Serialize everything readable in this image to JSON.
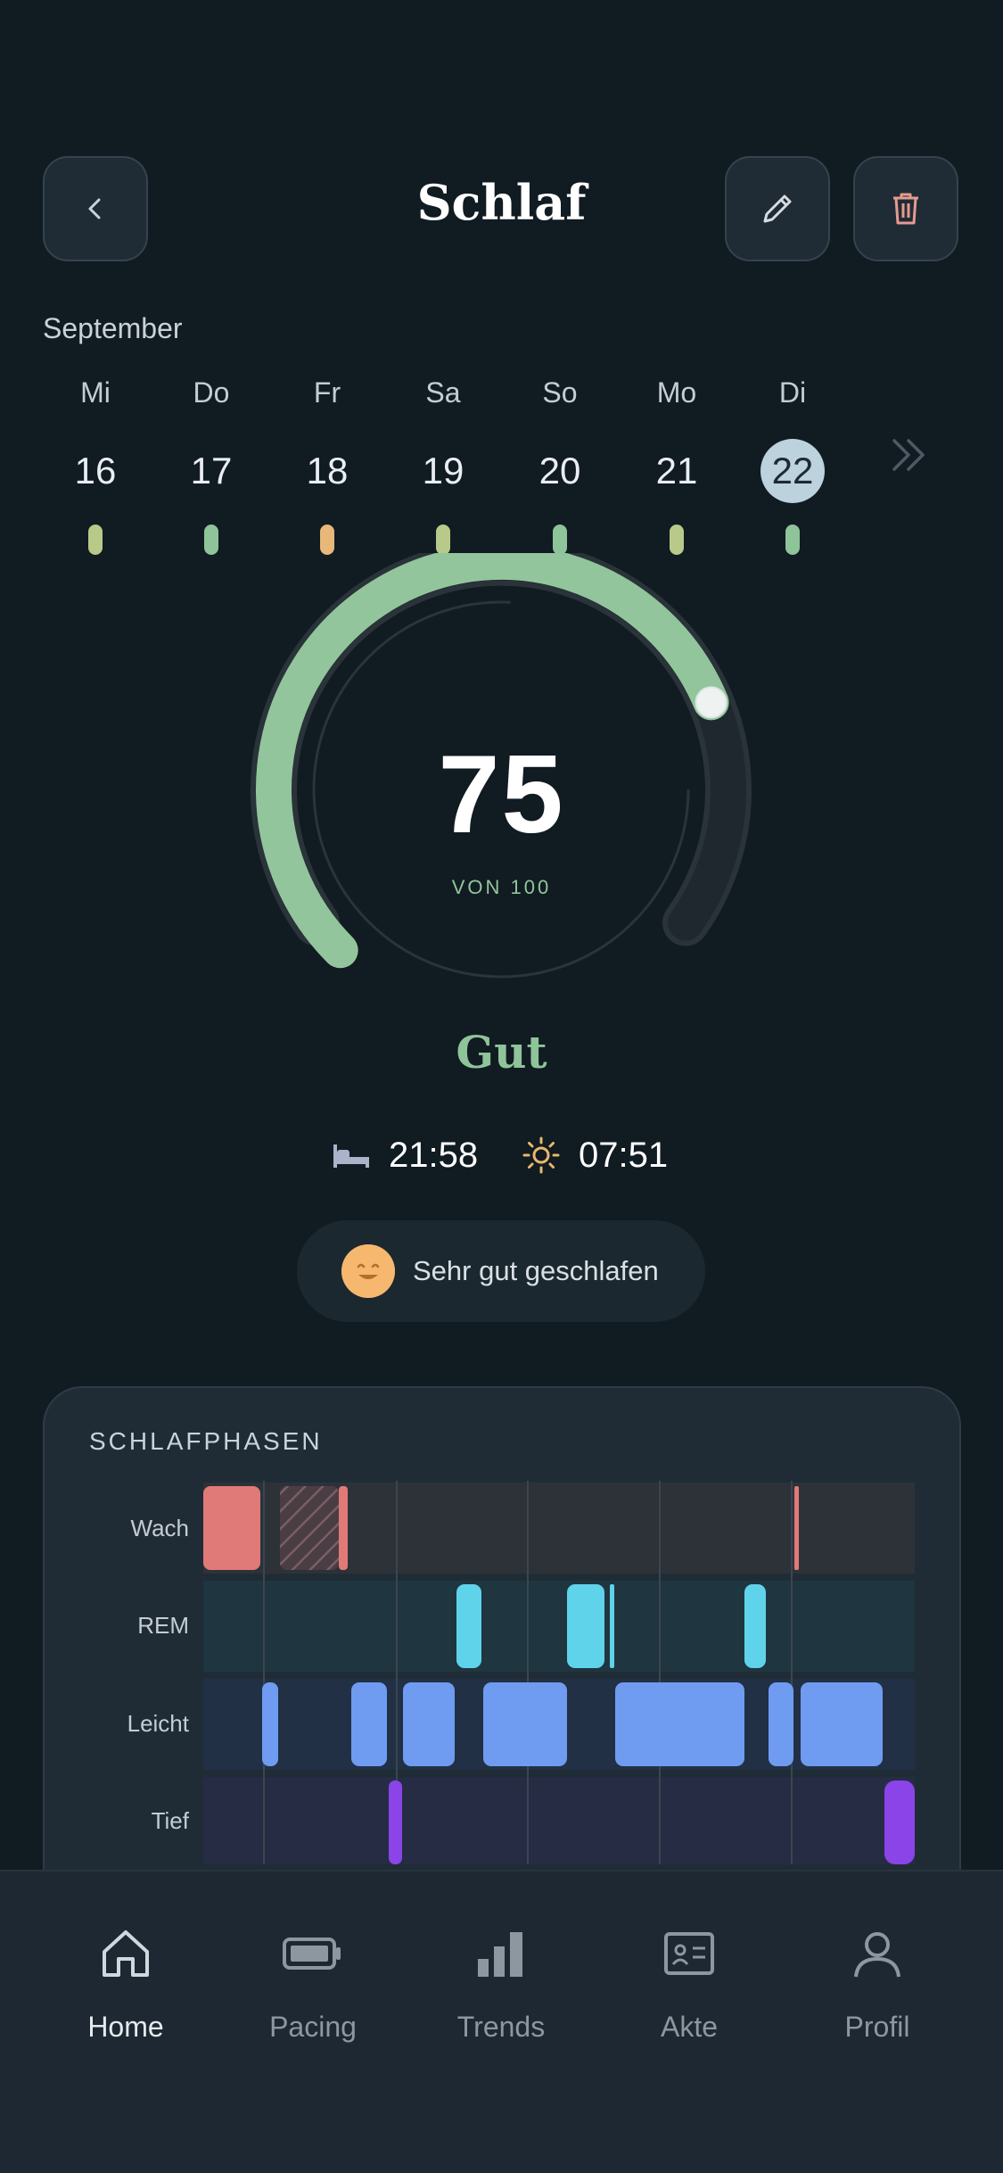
{
  "header": {
    "title": "Schlaf",
    "back_icon": "chevron-left-icon",
    "edit_icon": "pencil-icon",
    "delete_icon": "trash-icon"
  },
  "calendar": {
    "month": "September",
    "days": [
      {
        "name": "Mi",
        "date": "16",
        "quality_color": "#b9c98a"
      },
      {
        "name": "Do",
        "date": "17",
        "quality_color": "#8fc49a"
      },
      {
        "name": "Fr",
        "date": "18",
        "quality_color": "#e8b77a"
      },
      {
        "name": "Sa",
        "date": "19",
        "quality_color": "#b9c98a"
      },
      {
        "name": "So",
        "date": "20",
        "quality_color": "#8fc49a"
      },
      {
        "name": "Mo",
        "date": "21",
        "quality_color": "#b9c98a"
      },
      {
        "name": "Di",
        "date": "22",
        "quality_color": "#8fc49a",
        "selected": true
      }
    ],
    "next_icon": "double-chevron-right-icon"
  },
  "score": {
    "value": "75",
    "max_label": "VON 100",
    "fraction": 0.75,
    "rating": "Gut",
    "arc_color": "#93c59c"
  },
  "times": {
    "bedtime": "21:58",
    "bedtime_icon": "bed-icon",
    "wake": "07:51",
    "wake_icon": "sun-icon"
  },
  "mood": {
    "label": "Sehr gut geschlafen",
    "icon": "smiling-face-icon"
  },
  "phases": {
    "title": "SCHLAFPHASEN",
    "labels": [
      "Wach",
      "REM",
      "Leicht",
      "Tief"
    ],
    "colors": {
      "Wach": "#e07a78",
      "REM": "#5fd3ea",
      "Leicht": "#6f9cf0",
      "Tief": "#8a44e8"
    }
  },
  "nav": {
    "items": [
      {
        "label": "Home",
        "icon": "home-icon",
        "active": true
      },
      {
        "label": "Pacing",
        "icon": "battery-icon"
      },
      {
        "label": "Trends",
        "icon": "bar-chart-icon"
      },
      {
        "label": "Akte",
        "icon": "id-card-icon"
      },
      {
        "label": "Profil",
        "icon": "user-icon"
      }
    ]
  }
}
